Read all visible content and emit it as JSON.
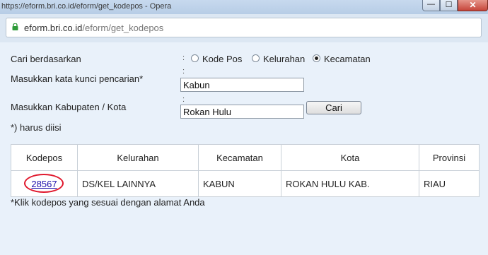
{
  "window": {
    "title": "https://eform.bri.co.id/eform/get_kodepos - Opera",
    "minimize_glyph": "—",
    "maximize_glyph": "☐",
    "close_glyph": "✕"
  },
  "address_bar": {
    "domain": "eform.bri.co.id",
    "path": "/eform/get_kodepos",
    "lock_icon": "lock-icon",
    "lock_color": "#2e9b39"
  },
  "form": {
    "search_by_label": "Cari berdasarkan",
    "colon": ":",
    "radio_options": [
      {
        "label": "Kode Pos",
        "checked": false
      },
      {
        "label": "Kelurahan",
        "checked": false
      },
      {
        "label": "Kecamatan",
        "checked": true
      }
    ],
    "keyword_label": "Masukkan kata kunci pencarian*",
    "keyword_value": "Kabun",
    "city_label": "Masukkan Kabupaten / Kota",
    "city_value": "Rokan Hulu",
    "search_button": "Cari",
    "required_note": "*) harus diisi"
  },
  "table": {
    "headers": [
      "Kodepos",
      "Kelurahan",
      "Kecamatan",
      "Kota",
      "Provinsi"
    ],
    "rows": [
      {
        "kodepos": "28567",
        "kelurahan": "DS/KEL LAINNYA",
        "kecamatan": "KABUN",
        "kota": "ROKAN HULU KAB.",
        "provinsi": "RIAU"
      }
    ]
  },
  "footer_note": "*Klik kodepos yang sesuai dengan alamat Anda",
  "colors": {
    "link": "#1a0dab",
    "highlight_circle": "#e0182d"
  }
}
